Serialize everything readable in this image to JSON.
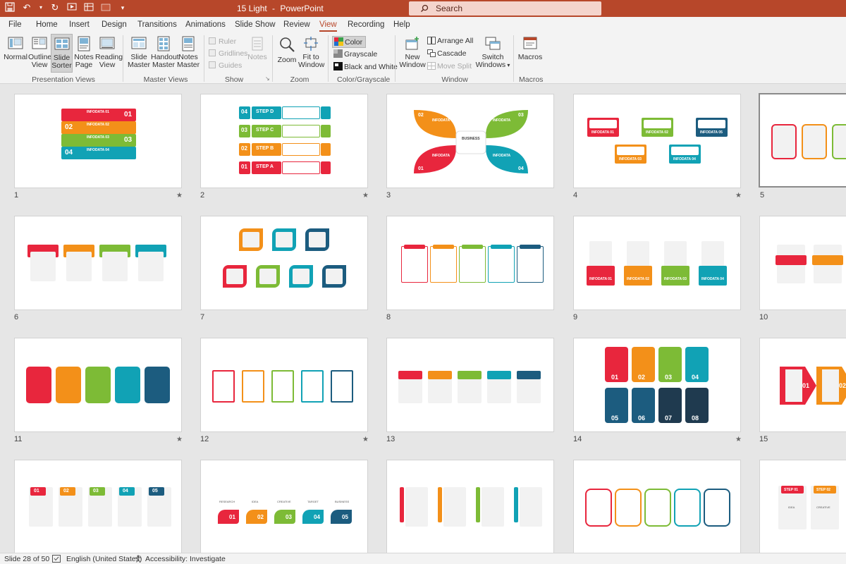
{
  "titlebar": {
    "file": "15 Light",
    "sep": "-",
    "app": "PowerPoint",
    "search_placeholder": "Search"
  },
  "menu": [
    "File",
    "Home",
    "Insert",
    "Design",
    "Transitions",
    "Animations",
    "Slide Show",
    "Review",
    "View",
    "Recording",
    "Help"
  ],
  "menu_active": "View",
  "ribbon": {
    "presentation_views": {
      "normal": "Normal",
      "outline": "Outline View",
      "outline1": "Outline",
      "outline2": "View",
      "sorter1": "Slide",
      "sorter2": "Sorter",
      "notes1": "Notes",
      "notes2": "Page",
      "reading1": "Reading",
      "reading2": "View",
      "label": "Presentation Views"
    },
    "master_views": {
      "slide1": "Slide",
      "slide2": "Master",
      "handout1": "Handout",
      "handout2": "Master",
      "notes1": "Notes",
      "notes2": "Master",
      "label": "Master Views"
    },
    "show": {
      "ruler": "Ruler",
      "gridlines": "Gridlines",
      "guides": "Guides",
      "notes": "Notes",
      "label": "Show"
    },
    "zoom": {
      "zoom": "Zoom",
      "fit1": "Fit to",
      "fit2": "Window",
      "label": "Zoom"
    },
    "color": {
      "color": "Color",
      "grayscale": "Grayscale",
      "bw": "Black and White",
      "label": "Color/Grayscale"
    },
    "window": {
      "new1": "New",
      "new2": "Window",
      "arrange": "Arrange All",
      "cascade": "Cascade",
      "move": "Move Split",
      "switch1": "Switch",
      "switch2": "Windows",
      "label": "Window"
    },
    "macros": {
      "macros": "Macros",
      "label": "Macros"
    }
  },
  "slides": {
    "n1": "1",
    "n2": "2",
    "n3": "3",
    "n4": "4",
    "n5": "5",
    "n6": "6",
    "n7": "7",
    "n8": "8",
    "n9": "9",
    "n10": "10",
    "n11": "11",
    "n12": "12",
    "n13": "13",
    "n14": "14",
    "n15": "15",
    "star": "★",
    "s1": {
      "r1": "01",
      "r2": "02",
      "r3": "03",
      "r4": "04",
      "t1": "INFODATA 01",
      "t2": "INFODATA 02",
      "t3": "INFODATA 03",
      "t4": "INFODATA 04"
    },
    "s2": {
      "n4": "04",
      "n3": "03",
      "n2": "02",
      "n1": "01",
      "d": "STEP D",
      "c": "STEP C",
      "b": "STEP B",
      "a": "STEP A"
    },
    "s3": {
      "tl": "INFODATA",
      "tr": "INFODATA",
      "bl": "INFODATA",
      "br": "INFODATA",
      "n02": "02",
      "n03": "03",
      "n01": "01",
      "n04": "04",
      "center": "BUSINESS"
    },
    "s4": {
      "a": "INFODATA 01",
      "b": "INFODATA 02",
      "c": "INFODATA 05",
      "d": "INFODATA 03",
      "e": "INFODATA 04"
    },
    "s9": {
      "a": "INFODATA 01",
      "b": "INFODATA 02",
      "c": "INFODATA 03",
      "d": "INFODATA 04"
    },
    "s14": {
      "a": "01",
      "b": "02",
      "c": "03",
      "d": "04",
      "e": "05",
      "f": "06",
      "g": "07",
      "h": "08"
    },
    "s15": {
      "a": "01",
      "b": "02"
    },
    "s16": {
      "a": "01",
      "b": "02",
      "c": "03",
      "d": "04",
      "e": "05"
    },
    "s17": {
      "a": "01",
      "b": "02",
      "c": "03",
      "d": "04",
      "e": "05",
      "r": "RESEARCH",
      "i": "IDEA",
      "cr": "CREATIVE",
      "t": "TARGET",
      "bu": "BUSINESS"
    },
    "s20": {
      "a": "STEP 01",
      "b": "STEP 02",
      "i": "IDEA",
      "c": "CREATIVE"
    }
  },
  "status": {
    "slide": "Slide 28 of 50",
    "lang": "English (United States)",
    "access": "Accessibility: Investigate"
  },
  "colors": {
    "red": "#e8263d",
    "orange": "#f39019",
    "green": "#7dbb36",
    "teal": "#11a2b5",
    "navy": "#1c5c7f",
    "brand": "#b7472a"
  }
}
